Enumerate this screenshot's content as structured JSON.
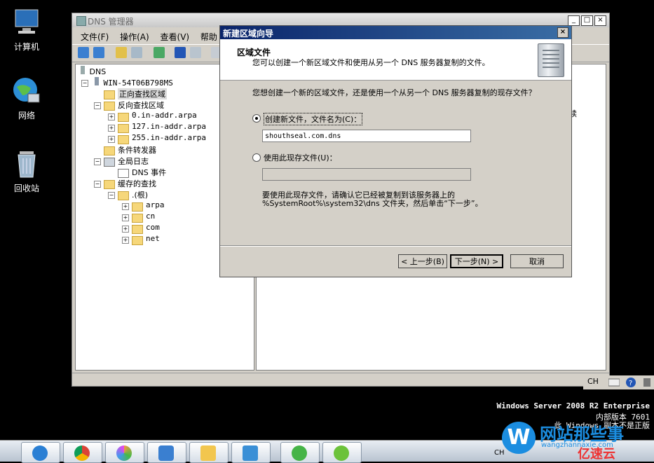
{
  "desktop": {
    "icons": [
      {
        "label": "计算机"
      },
      {
        "label": "网络"
      },
      {
        "label": "回收站"
      }
    ]
  },
  "mmc": {
    "title": "DNS 管理器",
    "menu": [
      "文件(F)",
      "操作(A)",
      "查看(V)",
      "帮助"
    ],
    "tree": {
      "root": "DNS",
      "server": "WIN-54T06B798MS",
      "forward": "正向查找区域",
      "reverse": "反向查找区域",
      "reverse_items": [
        "0.in-addr.arpa",
        "127.in-addr.arpa",
        "255.in-addr.arpa"
      ],
      "conditional": "条件转发器",
      "global_logs": "全局日志",
      "dns_events": "DNS 事件",
      "cached": "缓存的查找",
      "root_hint": ".(根)",
      "cache_items": [
        "arpa",
        "cn",
        "com",
        "net"
      ]
    },
    "right_fragment": "续"
  },
  "wizard": {
    "title": "新建区域向导",
    "header_title": "区域文件",
    "header_desc": "您可以创建一个新区域文件和使用从另一个 DNS 服务器复制的文件。",
    "question": "您想创建一个新的区域文件，还是使用一个从另一个 DNS 服务器复制的现存文件？",
    "option_new": "创建新文件，文件名为(C)：",
    "new_filename": "shouthseal.com.dns",
    "option_existing": "使用此现存文件(U)：",
    "existing_filename": "",
    "note": "要使用此现存文件，请确认它已经被复制到该服务器上的 %SystemRoot%\\system32\\dns 文件夹，然后单击“下一步”。",
    "btn_back": "< 上一步(B)",
    "btn_next": "下一步(N) >",
    "btn_cancel": "取消"
  },
  "os": {
    "edition": "Windows Server 2008 R2 Enterprise",
    "build": "内部版本 7601",
    "genuine": "此 Windows 副本不是正版"
  },
  "tray": {
    "lang": "CH"
  },
  "taskbar": {
    "lang": "CH"
  },
  "watermark": {
    "logo_letter": "W",
    "brand": "网站那些事",
    "url": "wangzhannaxie.com",
    "yisu": "亿速云"
  }
}
